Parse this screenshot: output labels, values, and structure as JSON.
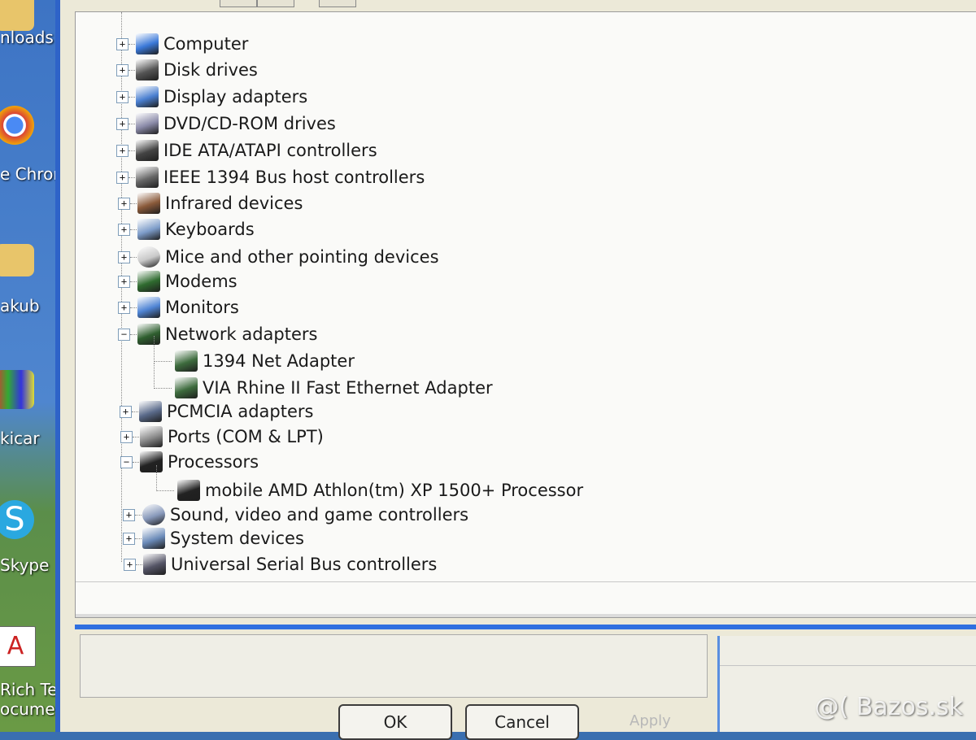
{
  "desktop": {
    "icons": [
      {
        "label": "nloads",
        "icon": "downloads-folder-icon"
      },
      {
        "label": "e Chron",
        "icon": "chrome-icon"
      },
      {
        "label": "akub",
        "icon": "folder-icon"
      },
      {
        "label": "kicar",
        "icon": "paint-icon"
      },
      {
        "label": "Skype",
        "icon": "skype-icon"
      },
      {
        "label": "Rich Te",
        "label2": "ocument",
        "icon": "rich-text-document-icon"
      }
    ]
  },
  "tree": [
    {
      "label": "Computer",
      "state": "collapsed",
      "icon": "computer-icon",
      "level": 1
    },
    {
      "label": "Disk drives",
      "state": "collapsed",
      "icon": "disk-drive-icon",
      "level": 1
    },
    {
      "label": "Display adapters",
      "state": "collapsed",
      "icon": "display-adapter-icon",
      "level": 1
    },
    {
      "label": "DVD/CD-ROM drives",
      "state": "collapsed",
      "icon": "dvd-drive-icon",
      "level": 1
    },
    {
      "label": "IDE ATA/ATAPI controllers",
      "state": "collapsed",
      "icon": "ide-controller-icon",
      "level": 1
    },
    {
      "label": "IEEE 1394 Bus host controllers",
      "state": "collapsed",
      "icon": "ieee1394-icon",
      "level": 1
    },
    {
      "label": "Infrared devices",
      "state": "collapsed",
      "icon": "infrared-icon",
      "level": 1
    },
    {
      "label": "Keyboards",
      "state": "collapsed",
      "icon": "keyboard-icon",
      "level": 1
    },
    {
      "label": "Mice and other pointing devices",
      "state": "collapsed",
      "icon": "mouse-icon",
      "level": 1
    },
    {
      "label": "Modems",
      "state": "collapsed",
      "icon": "modem-icon",
      "level": 1
    },
    {
      "label": "Monitors",
      "state": "collapsed",
      "icon": "monitor-icon",
      "level": 1
    },
    {
      "label": "Network adapters",
      "state": "expanded",
      "icon": "network-adapter-icon",
      "level": 1
    },
    {
      "label": "1394 Net Adapter",
      "icon": "network-card-icon",
      "level": 2
    },
    {
      "label": "VIA Rhine II Fast Ethernet Adapter",
      "icon": "network-card-icon",
      "level": 2
    },
    {
      "label": "PCMCIA adapters",
      "state": "collapsed",
      "icon": "pcmcia-icon",
      "level": 1
    },
    {
      "label": "Ports (COM & LPT)",
      "state": "collapsed",
      "icon": "port-icon",
      "level": 1
    },
    {
      "label": "Processors",
      "state": "expanded",
      "icon": "processor-icon",
      "level": 1
    },
    {
      "label": "mobile AMD Athlon(tm) XP 1500+ Processor",
      "icon": "cpu-chip-icon",
      "level": 2
    },
    {
      "label": "Sound, video and game controllers",
      "state": "collapsed",
      "icon": "sound-icon",
      "level": 1
    },
    {
      "label": "System devices",
      "state": "collapsed",
      "icon": "system-device-icon",
      "level": 1
    },
    {
      "label": "Universal Serial Bus controllers",
      "state": "collapsed",
      "icon": "usb-icon",
      "level": 1
    }
  ],
  "buttons": {
    "ok": "OK",
    "cancel": "Cancel",
    "apply": "Apply"
  },
  "watermark": "@( Bazos.sk"
}
